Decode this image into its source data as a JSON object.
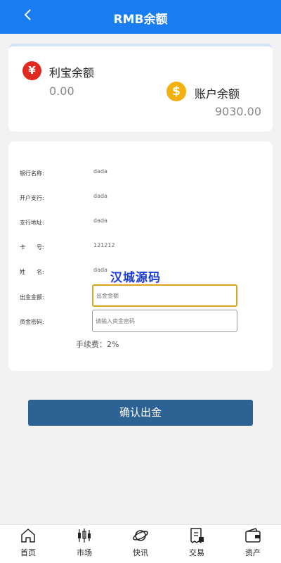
{
  "header": {
    "title": "RMB余额"
  },
  "balances": {
    "libao": {
      "icon": "yuan-icon",
      "symbol": "¥",
      "label": "利宝余额",
      "value": "0.00"
    },
    "account": {
      "icon": "dollar-coin-icon",
      "symbol": "$",
      "label": "账户余额",
      "value": "9030.00"
    }
  },
  "form": {
    "rows": [
      {
        "label": "银行名称:",
        "value": "dada"
      },
      {
        "label": "开户支行:",
        "value": "dada"
      },
      {
        "label": "支行地址:",
        "value": "dada"
      },
      {
        "label": "卡　　号:",
        "value": "121212"
      },
      {
        "label": "姓　　名:",
        "value": "dada"
      }
    ],
    "amount_label": "出金金额:",
    "amount_placeholder": "出金金额",
    "amount_value": "",
    "password_label": "资金密码:",
    "password_placeholder": "请输入资金密码",
    "password_value": "",
    "fee_text": "手续费：2%"
  },
  "watermark": "汉城源码",
  "confirm_label": "确认出金",
  "tabbar": [
    {
      "label": "首页",
      "icon": "home-icon"
    },
    {
      "label": "市场",
      "icon": "candlestick-icon"
    },
    {
      "label": "快讯",
      "icon": "planet-icon"
    },
    {
      "label": "交易",
      "icon": "receipt-icon"
    },
    {
      "label": "资产",
      "icon": "wallet-icon"
    }
  ],
  "colors": {
    "header": "#1a7cf1",
    "confirm": "#2d6294",
    "yuan": "#e0291f",
    "coin": "#f3b10f",
    "active_input_border": "#d9a520"
  }
}
